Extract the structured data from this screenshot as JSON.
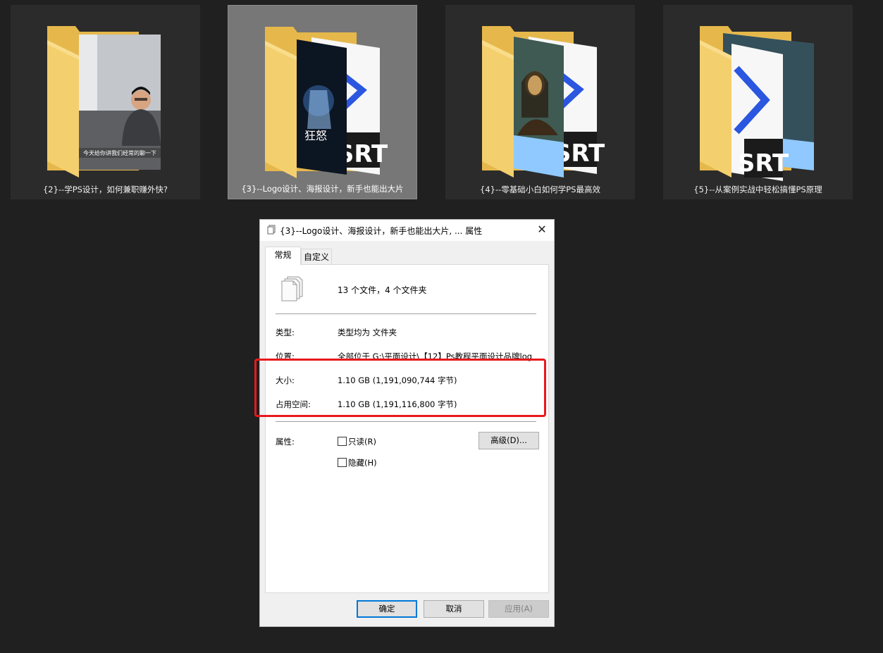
{
  "folders": [
    {
      "caption": "{2}--学PS设计，如何兼职赚外快?",
      "thumb_subtitle": "今天给你讲我们经常的聊一下"
    },
    {
      "caption": "{3}--Logo设计、海报设计，新手也能出大片",
      "thumb_poster_text": "狂怒",
      "badge": "SRT"
    },
    {
      "caption": "{4}--零基础小白如何学PS最高效",
      "badge": "SRT"
    },
    {
      "caption": "{5}--从案例实战中轻松搞懂PS原理",
      "badge": "SRT"
    }
  ],
  "dialog": {
    "title": "{3}--Logo设计、海报设计，新手也能出大片, ... 属性",
    "close_glyph": "✕",
    "tabs": [
      {
        "label": "常规"
      },
      {
        "label": "自定义"
      }
    ],
    "summary": "13 个文件，4 个文件夹",
    "type_label": "类型:",
    "type_value": "类型均为 文件夹",
    "location_label": "位置:",
    "location_value": "全部位于 G:\\平面设计\\【12】Ps教程平面设计品牌log",
    "size_label": "大小:",
    "size_value": "1.10 GB (1,191,090,744 字节)",
    "disk_label": "占用空间:",
    "disk_value": "1.10 GB (1,191,116,800 字节)",
    "attr_label": "属性:",
    "readonly_label": "只读(R)",
    "hidden_label": "隐藏(H)",
    "advanced_button": "高级(D)...",
    "ok_button": "确定",
    "cancel_button": "取消",
    "apply_button": "应用(A)"
  },
  "colors": {
    "background": "#202020",
    "selected_tile": "#777777",
    "highlight_box": "#e8191c",
    "folder_yellow": "#f4cf6e",
    "accent_blue": "#0078d7"
  }
}
